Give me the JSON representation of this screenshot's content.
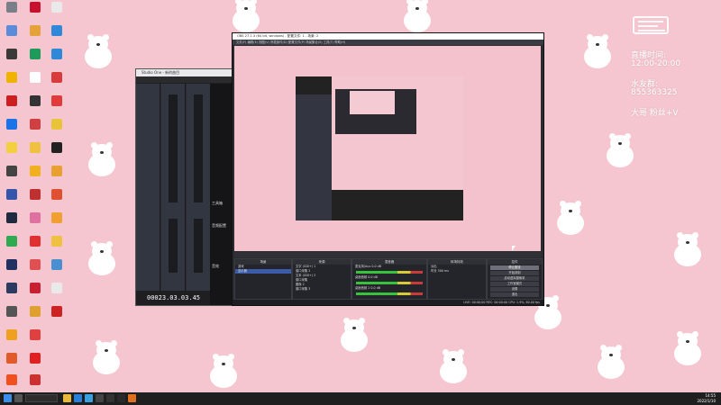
{
  "overlay": {
    "hours_title": "直播时间:",
    "hours_range": "12:00-20:00",
    "qq_label": "水友群:",
    "qq_number": "855363325",
    "fans_label": "大哥 粉丝+V"
  },
  "studio_one": {
    "title": "Studio One - 新的曲目",
    "timecode": "00023.03.03.45",
    "side_labels": [
      "工具箱",
      "音频配置",
      "音效"
    ]
  },
  "obs": {
    "title": "OBS 27.1.3 (64 bit, windows) - 配置文件: 1 - 场景: 2",
    "menu": [
      "文件(F)",
      "编辑(E)",
      "视图(V)",
      "停靠部件(D)",
      "配置文件(P)",
      "场景集合(S)",
      "工具(T)",
      "帮助(H)"
    ],
    "docks": {
      "scenes": {
        "header": "场景",
        "items": [
          "游戏",
          "显示器"
        ]
      },
      "sources": {
        "header": "来源",
        "items": [
          "文字 (GDI+) 1",
          "窗口采集 2",
          "文本 (GDI+) 2",
          "窗口采集",
          "图像 2",
          "窗口采集 3",
          "显示器采集",
          "音频 2",
          "显示器 2"
        ]
      },
      "mixer": {
        "header": "混音器",
        "channels": [
          "麦克风/Aux",
          "桌面音频",
          "桌面音频 2"
        ],
        "levels": [
          "0.0 dB",
          "0.0 dB",
          "0.0 dB"
        ]
      },
      "transitions": {
        "header": "转场特效",
        "type": "淡出",
        "duration_label": "时长",
        "duration_value": "300 ms"
      },
      "controls": {
        "header": "控件",
        "buttons": [
          "停止推流",
          "开始录制",
          "启动虚拟摄像机",
          "工作室模式",
          "设置",
          "退出"
        ]
      }
    },
    "status": "LIVE: 00:00:00  REC: 00:00:00  CPU: 1.9%, 60.00 fps"
  },
  "taskbar": {
    "time": "14:55",
    "date": "2022/1/10"
  },
  "colors": {
    "wallpaper": "#f6c6d0",
    "obs_bg": "#2b2c33",
    "taskbar": "#1f1f1f"
  }
}
